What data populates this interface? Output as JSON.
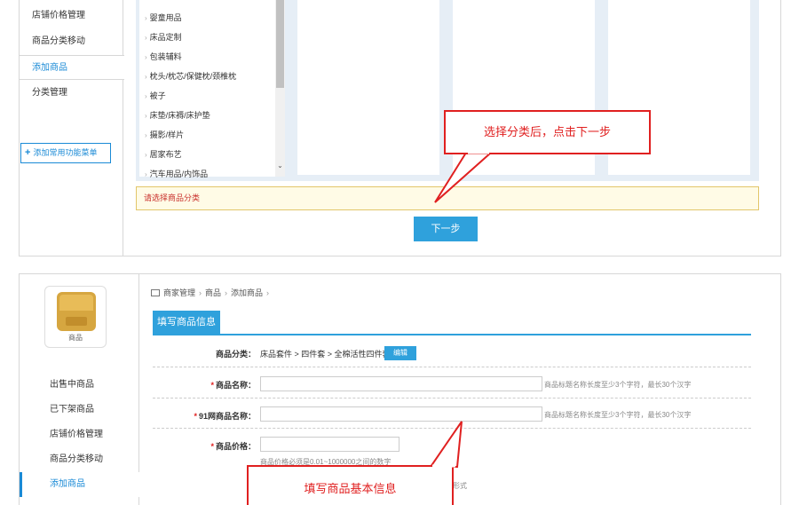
{
  "top_sidebar": {
    "items": [
      "店铺价格管理",
      "商品分类移动",
      "添加商品",
      "分类管理"
    ],
    "add_function": "添加常用功能菜单"
  },
  "categories": [
    "婴童用品",
    "床品定制",
    "包装辅料",
    "枕头/枕芯/保健枕/颈椎枕",
    "被子",
    "床垫/床褥/床护垫",
    "摄影/样片",
    "居家布艺",
    "汽车用品/内饰品"
  ],
  "prompt": "请选择商品分类",
  "next_button": "下一步",
  "callout_top": "选择分类后，点击下一步",
  "bottom_sidebar": {
    "avatar_label": "商品",
    "items": [
      "出售中商品",
      "已下架商品",
      "店铺价格管理",
      "商品分类移动",
      "添加商品"
    ]
  },
  "breadcrumb": [
    "商家管理",
    "商品",
    "添加商品"
  ],
  "form": {
    "tab": "填写商品信息",
    "category_label": "商品分类：",
    "category_path": "床品套件 > 四件套 > 全棉活性四件套",
    "edit_button": "编辑",
    "name_label": "商品名称：",
    "name_hint": "商品标题名称长度至少3个字符，最长30个汉字",
    "name91_label": "91网商品名称：",
    "name91_hint": "商品标题名称长度至少3个字符，最长30个汉字",
    "price_label": "商品价格：",
    "price_hint": "商品价格必须是0.01~1000000之间的数字",
    "partial_hint": "形式"
  },
  "callout_bottom": "填写商品基本信息"
}
